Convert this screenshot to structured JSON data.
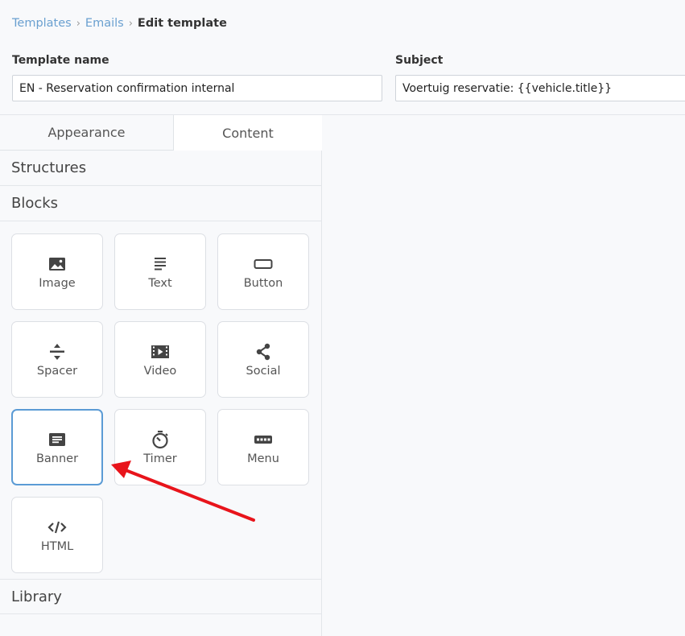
{
  "breadcrumb": {
    "items": [
      "Templates",
      "Emails"
    ],
    "separator": "›",
    "current": "Edit template"
  },
  "form": {
    "template_name_label": "Template name",
    "template_name_value": "EN - Reservation confirmation internal",
    "subject_label": "Subject",
    "subject_value": "Voertuig reservatie: {{vehicle.title}}"
  },
  "tabs": {
    "appearance": "Appearance",
    "content": "Content",
    "active": "Content"
  },
  "sections": {
    "structures": "Structures",
    "blocks": "Blocks",
    "library": "Library"
  },
  "blocks": [
    {
      "label": "Image",
      "icon": "image-icon"
    },
    {
      "label": "Text",
      "icon": "text-icon"
    },
    {
      "label": "Button",
      "icon": "button-icon"
    },
    {
      "label": "Spacer",
      "icon": "spacer-icon"
    },
    {
      "label": "Video",
      "icon": "video-icon"
    },
    {
      "label": "Social",
      "icon": "share-icon"
    },
    {
      "label": "Banner",
      "icon": "banner-icon",
      "selected": true
    },
    {
      "label": "Timer",
      "icon": "timer-icon"
    },
    {
      "label": "Menu",
      "icon": "menu-icon"
    },
    {
      "label": "HTML",
      "icon": "code-icon"
    }
  ],
  "colors": {
    "accent": "#5b9bd5",
    "link": "#6aa0d0",
    "annotation_arrow": "#e8141b"
  }
}
